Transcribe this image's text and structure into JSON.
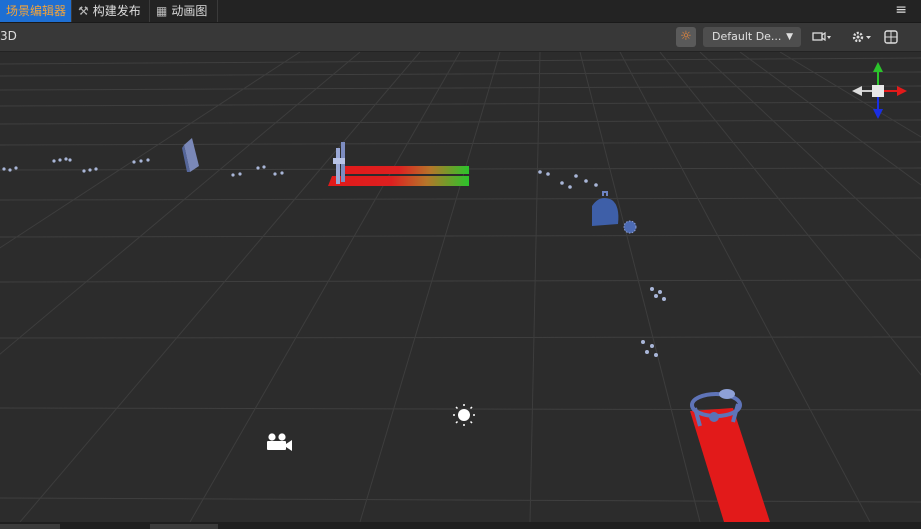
{
  "tabs": [
    {
      "label": "场景编辑器",
      "icon": "scene-icon",
      "active": true
    },
    {
      "label": "构建发布",
      "icon": "hammer-icon",
      "active": false
    },
    {
      "label": "动画图",
      "icon": "animation-icon",
      "active": false
    }
  ],
  "menu_icon": "hamburger-icon",
  "toolbar": {
    "mode": "3D",
    "camera_dropdown": "Default De...",
    "icons": [
      "sun-icon",
      "video-camera-icon",
      "gear-icon",
      "grid-icon"
    ]
  },
  "gizmo": {
    "axes": [
      "x-axis-arrow-icon",
      "y-axis-arrow-icon",
      "z-axis-arrow-icon"
    ]
  },
  "colors": {
    "accent_tab": "#1e6fd3",
    "active_tab_text": "#f2a33a",
    "red": "#e21a1a",
    "green": "#2bc42b",
    "blue_model": "#3e5fa8"
  }
}
